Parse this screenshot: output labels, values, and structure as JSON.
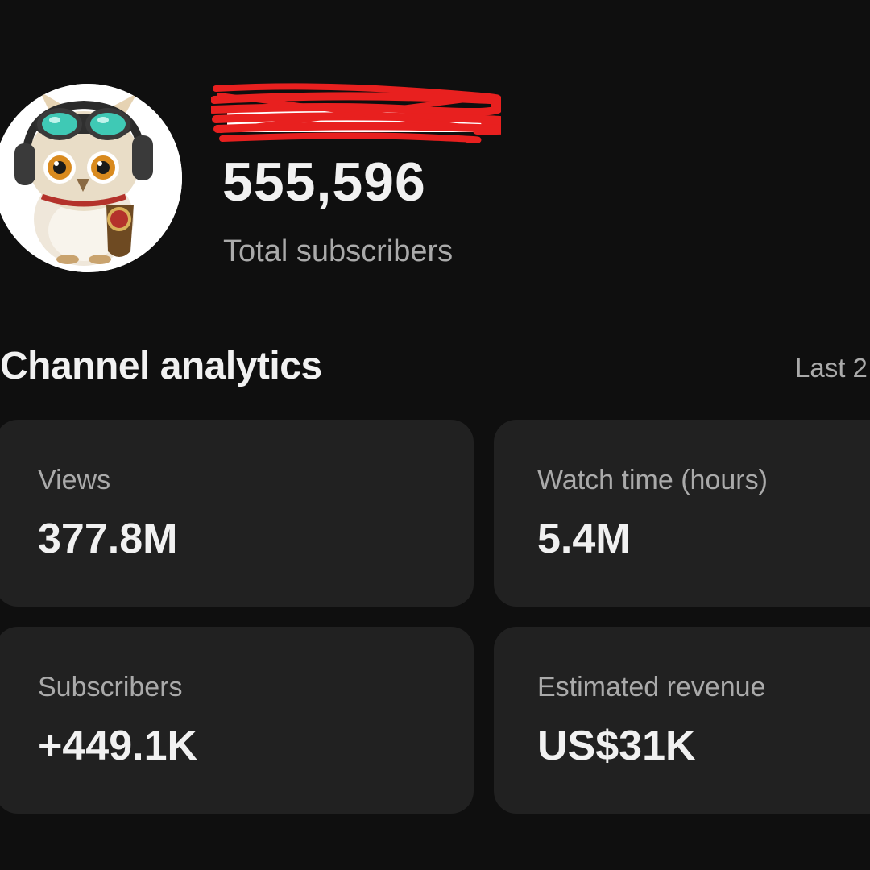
{
  "channel": {
    "avatar_icon": "owl-mascot-avatar",
    "name_redacted": true,
    "subscriber_count": "555,596",
    "subscriber_caption": "Total subscribers"
  },
  "analytics": {
    "title": "Channel analytics",
    "period_label": "Last 2",
    "cards": [
      {
        "label": "Views",
        "value": "377.8M"
      },
      {
        "label": "Watch time (hours)",
        "value": "5.4M"
      },
      {
        "label": "Subscribers",
        "value": "+449.1K"
      },
      {
        "label": "Estimated revenue",
        "value": "US$31K"
      }
    ]
  },
  "colors": {
    "background": "#0f0f0f",
    "card": "#212121",
    "text_primary": "#f1f1f1",
    "text_secondary": "#aaaaaa",
    "redaction": "#e8201f"
  }
}
